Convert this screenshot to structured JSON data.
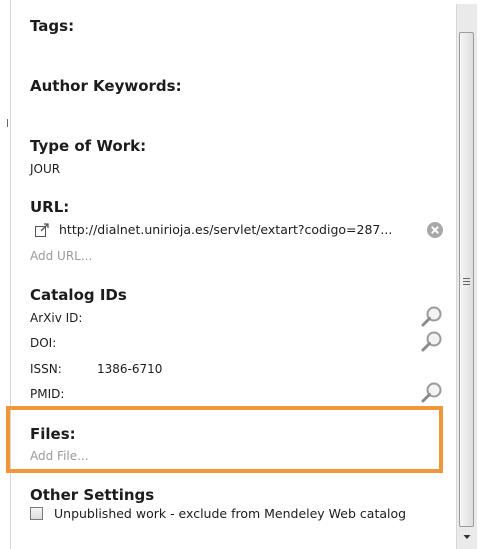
{
  "sections": {
    "tags": {
      "heading": "Tags:"
    },
    "author_keywords": {
      "heading": "Author Keywords:"
    },
    "type_of_work": {
      "heading": "Type of Work:",
      "value": "JOUR"
    },
    "url": {
      "heading": "URL:",
      "value": "http://dialnet.unirioja.es/servlet/extart?codigo=287...",
      "add_label": "Add URL...",
      "icons": {
        "open": "external-link-icon",
        "remove": "remove-circle-icon"
      }
    },
    "catalog_ids": {
      "heading": "Catalog IDs",
      "rows": [
        {
          "label": "ArXiv ID:",
          "value": "",
          "lookup": true
        },
        {
          "label": "DOI:",
          "value": "",
          "lookup": true
        },
        {
          "label": "ISSN:",
          "value": "1386-6710",
          "lookup": false
        },
        {
          "label": "PMID:",
          "value": "",
          "lookup": true
        }
      ],
      "lookup_icon": "magnifier-icon"
    },
    "files": {
      "heading": "Files:",
      "add_label": "Add File..."
    },
    "other_settings": {
      "heading": "Other Settings",
      "unpublished_label": "Unpublished work - exclude from Mendeley Web catalog",
      "unpublished_checked": false
    }
  },
  "colors": {
    "highlight_border": "#f0973a",
    "muted_link": "#9a9a9a",
    "text": "#1c1c1c"
  }
}
